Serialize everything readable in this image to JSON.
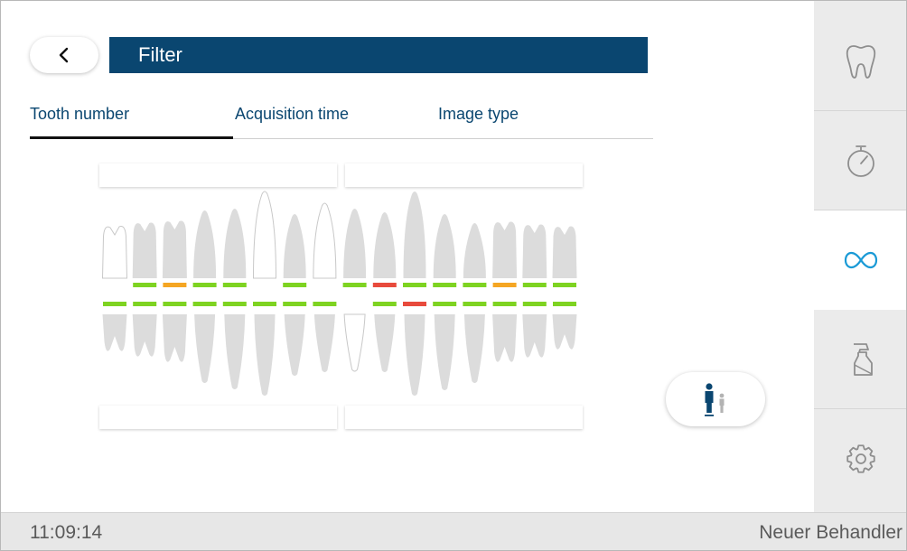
{
  "header": {
    "title": "Filter",
    "back_icon": "chevron-left-icon"
  },
  "tabs": [
    {
      "label": "Tooth number",
      "active": true
    },
    {
      "label": "Acquisition time",
      "active": false
    },
    {
      "label": "Image type",
      "active": false
    }
  ],
  "colors": {
    "title_bar": "#0a4670",
    "tab_text": "#0a4670",
    "tooth_fill": "#dcdcdc",
    "status_green": "#7ed321",
    "status_orange": "#f5a623",
    "status_red": "#e84a3c",
    "accent": "#1a9ad6"
  },
  "dental_chart": {
    "upper": [
      {
        "tooth": 18,
        "style": "outline",
        "status": null
      },
      {
        "tooth": 17,
        "style": "filled",
        "status": "green"
      },
      {
        "tooth": 16,
        "style": "filled",
        "status": "orange"
      },
      {
        "tooth": 15,
        "style": "filled",
        "status": "green"
      },
      {
        "tooth": 14,
        "style": "filled",
        "status": "green"
      },
      {
        "tooth": 13,
        "style": "outline",
        "status": null
      },
      {
        "tooth": 12,
        "style": "filled",
        "status": "green"
      },
      {
        "tooth": 11,
        "style": "outline",
        "status": null
      },
      {
        "tooth": 21,
        "style": "filled",
        "status": "green"
      },
      {
        "tooth": 22,
        "style": "filled",
        "status": "red"
      },
      {
        "tooth": 23,
        "style": "filled",
        "status": "green"
      },
      {
        "tooth": 24,
        "style": "filled",
        "status": "green"
      },
      {
        "tooth": 25,
        "style": "filled",
        "status": "green"
      },
      {
        "tooth": 26,
        "style": "filled",
        "status": "orange"
      },
      {
        "tooth": 27,
        "style": "filled",
        "status": "green"
      },
      {
        "tooth": 28,
        "style": "filled",
        "status": "green"
      }
    ],
    "lower": [
      {
        "tooth": 48,
        "style": "filled",
        "status": "green"
      },
      {
        "tooth": 47,
        "style": "filled",
        "status": "green"
      },
      {
        "tooth": 46,
        "style": "filled",
        "status": "green"
      },
      {
        "tooth": 45,
        "style": "filled",
        "status": "green"
      },
      {
        "tooth": 44,
        "style": "filled",
        "status": "green"
      },
      {
        "tooth": 43,
        "style": "filled",
        "status": "green"
      },
      {
        "tooth": 42,
        "style": "filled",
        "status": "green"
      },
      {
        "tooth": 41,
        "style": "filled",
        "status": "green"
      },
      {
        "tooth": 31,
        "style": "outline",
        "status": null
      },
      {
        "tooth": 32,
        "style": "filled",
        "status": "green"
      },
      {
        "tooth": 33,
        "style": "filled",
        "status": "red"
      },
      {
        "tooth": 34,
        "style": "filled",
        "status": "green"
      },
      {
        "tooth": 35,
        "style": "filled",
        "status": "green"
      },
      {
        "tooth": 36,
        "style": "filled",
        "status": "green"
      },
      {
        "tooth": 37,
        "style": "filled",
        "status": "green"
      },
      {
        "tooth": 38,
        "style": "filled",
        "status": "green"
      }
    ]
  },
  "person_toggle": {
    "icons": [
      "adult-icon",
      "child-icon"
    ],
    "selected": "adult"
  },
  "sidebar": {
    "items": [
      {
        "name": "tooth-icon",
        "active": false
      },
      {
        "name": "timer-icon",
        "active": false
      },
      {
        "name": "infinity-icon",
        "active": true
      },
      {
        "name": "spray-bottle-icon",
        "active": false
      },
      {
        "name": "gear-icon",
        "active": false
      }
    ]
  },
  "status_bar": {
    "time": "11:09:14",
    "user": "Neuer Behandler"
  }
}
